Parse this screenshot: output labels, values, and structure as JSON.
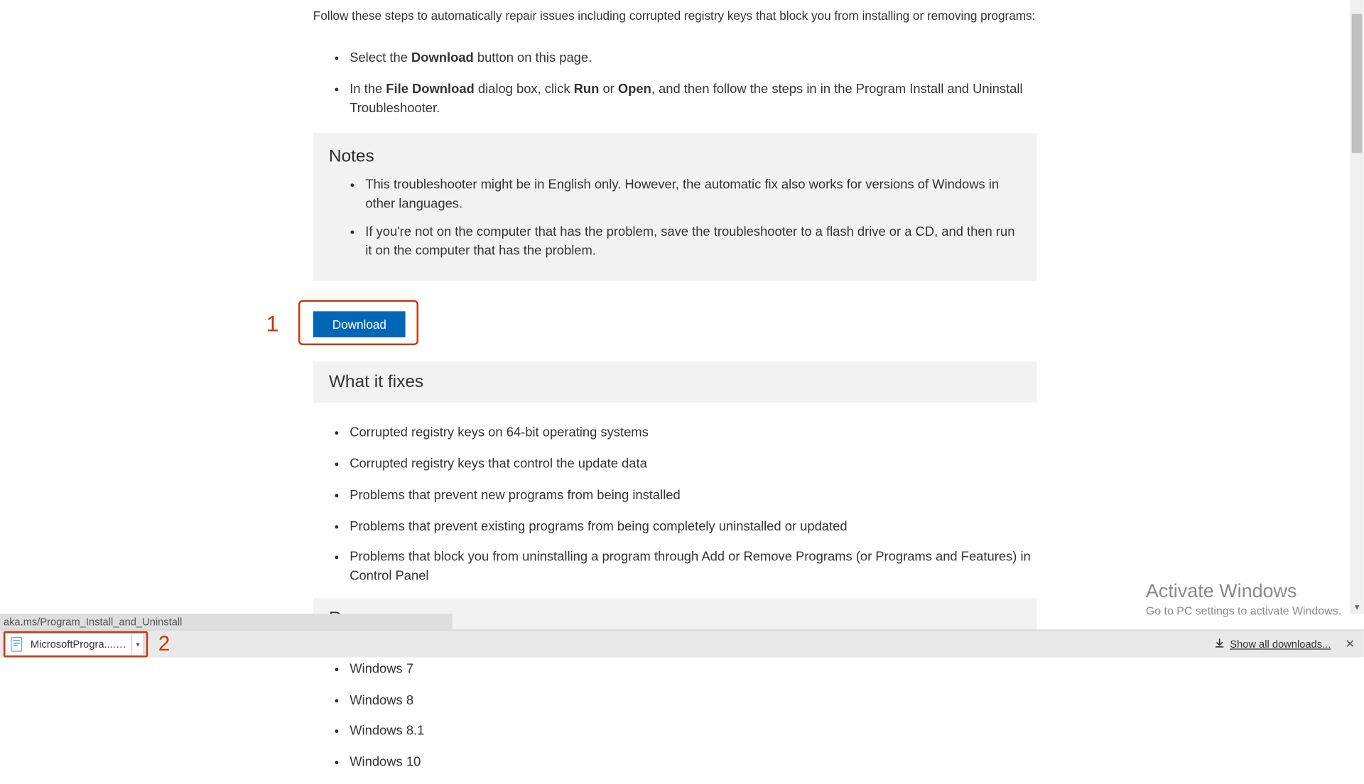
{
  "intro": "Follow these steps to automatically repair issues including corrupted registry keys that block you from installing or removing programs:",
  "steps": {
    "s1_prefix": "Select the ",
    "s1_bold": "Download",
    "s1_suffix": " button on this page.",
    "s2_prefix": "In the ",
    "s2_b1": "File Download",
    "s2_mid1": " dialog box, click ",
    "s2_b2": "Run",
    "s2_mid2": " or ",
    "s2_b3": "Open",
    "s2_suffix": ", and then follow the steps in in the Program Install and Uninstall Troubleshooter."
  },
  "notes": {
    "title": "Notes",
    "items": [
      "This troubleshooter might be in English only. However, the automatic fix also works for versions of Windows in other languages.",
      "If you're not on the computer that has the problem, save the troubleshooter to a flash drive or a CD, and then run it on the computer that has the problem."
    ]
  },
  "download_button": "Download",
  "annot": {
    "one": "1",
    "two": "2"
  },
  "what_it_fixes": {
    "title": "What it fixes",
    "items": [
      "Corrupted registry keys on 64-bit operating systems",
      "Corrupted registry keys that control the update data",
      "Problems that prevent new programs from being installed",
      "Problems that prevent existing programs from being completely uninstalled or updated",
      "Problems that block you from uninstalling a program through Add or Remove Programs (or Programs and Features) in Control Panel"
    ]
  },
  "runs_on": {
    "title": "Runs on",
    "items": [
      "Windows 7",
      "Windows 8",
      "Windows 8.1",
      "Windows 10"
    ]
  },
  "status_url": "aka.ms/Program_Install_and_Uninstall",
  "download_shelf": {
    "filename": "MicrosoftProgra....diagcab",
    "show_all": "Show all downloads..."
  },
  "watermark": {
    "line1": "Activate Windows",
    "line2": "Go to PC settings to activate Windows."
  }
}
